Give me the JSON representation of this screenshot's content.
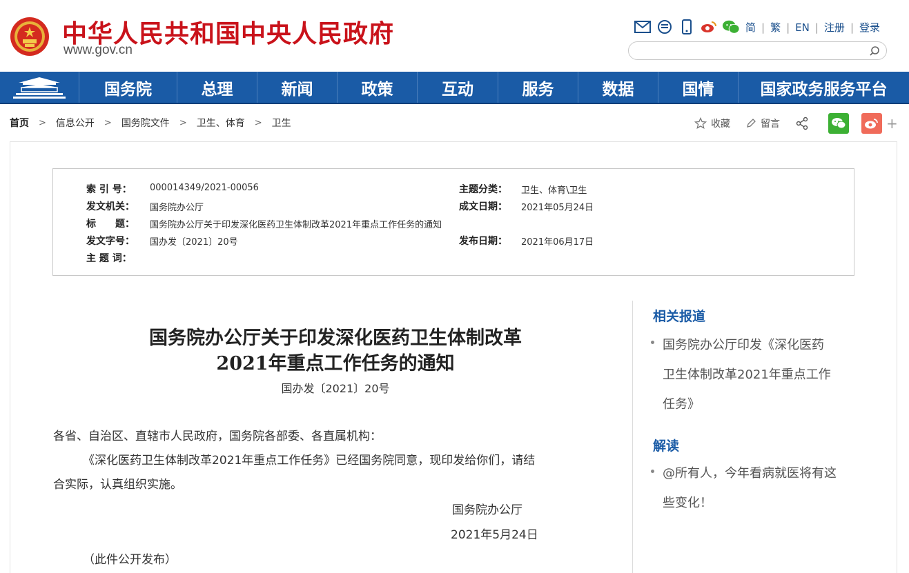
{
  "header": {
    "site_title": "中华人民共和国中央人民政府",
    "site_url": "www.gov.cn",
    "top_links": [
      "简",
      "繁",
      "EN",
      "注册",
      "登录"
    ],
    "search_placeholder": "",
    "brand_color": "#c9121a",
    "nav_color": "#1a5ba6"
  },
  "nav": {
    "items": [
      "国务院",
      "总理",
      "新闻",
      "政策",
      "互动",
      "服务",
      "数据",
      "国情",
      "国家政务服务平台"
    ]
  },
  "breadcrumb": [
    "首页",
    "信息公开",
    "国务院文件",
    "卫生、体育",
    "卫生"
  ],
  "share": {
    "favorite_label": "收藏",
    "comment_label": "留言",
    "plus": "+"
  },
  "info": {
    "index_label": "索 引 号：",
    "index_value": "000014349/2021-00056",
    "topic_label": "主题分类：",
    "topic_value": "卫生、体育\\卫生",
    "issuer_label": "发文机关：",
    "issuer_value": "国务院办公厅",
    "date_made_label": "成文日期：",
    "date_made_value": "2021年05月24日",
    "title_label": "标　　题：",
    "title_value": "国务院办公厅关于印发深化医药卫生体制改革2021年重点工作任务的通知",
    "docno_label": "发文字号：",
    "docno_value": "国办发〔2021〕20号",
    "publish_label": "发布日期：",
    "publish_value": "2021年06月17日",
    "keywords_label": "主 题 词：",
    "keywords_value": ""
  },
  "document": {
    "title_line1": "国务院办公厅关于印发深化医药卫生体制改革",
    "title_line2": "2021年重点工作任务的通知",
    "number": "国办发〔2021〕20号",
    "salutation": "各省、自治区、直辖市人民政府，国务院各部委、各直属机构：",
    "para1_line1": "《深化医药卫生体制改革2021年重点工作任务》已经国务院同意，现印发给你们，请结",
    "para1_line2": "合实际，认真组织实施。",
    "signature": "国务院办公厅",
    "sign_date": "2021年5月24日",
    "note": "（此件公开发布）"
  },
  "sidebar": {
    "related_heading": "相关报道",
    "related_items": [
      "国务院办公厅印发《深化医药",
      "卫生体制改革2021年重点工作",
      "任务》"
    ],
    "interpret_heading": "解读",
    "interpret_items": [
      "@所有人，今年看病就医将有这",
      "些变化！"
    ]
  }
}
